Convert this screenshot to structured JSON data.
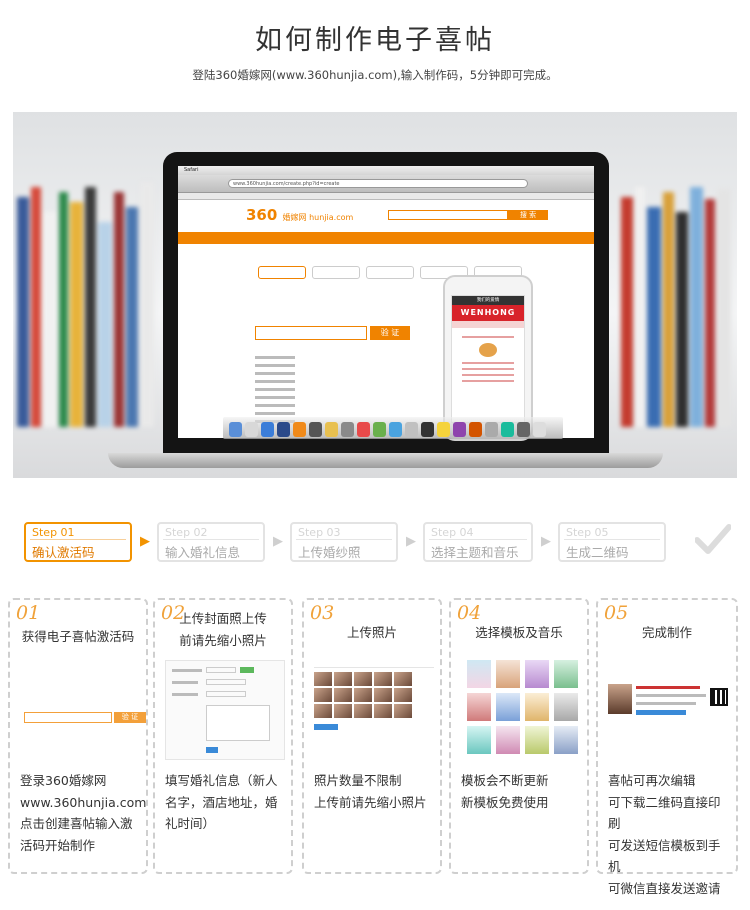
{
  "header": {
    "title": "如何制作电子喜帖",
    "subtitle": "登陆360婚嫁网(www.360hunjia.com),输入制作码，5分钟即可完成。"
  },
  "hero": {
    "browser_url": "www.360hunjia.com/create.php?id=create",
    "site_logo": "360",
    "site_logo_sub": "婚嫁网 hunjia.com",
    "site_search_btn": "搜 索",
    "screen_btn": "验 证",
    "phone_title": "我们的爱情",
    "phone_banner": "WENHONG",
    "menubar_app": "Safari"
  },
  "steps": [
    {
      "num": "Step 01",
      "label": "确认激活码",
      "active": true
    },
    {
      "num": "Step 02",
      "label": "输入婚礼信息",
      "active": false
    },
    {
      "num": "Step 03",
      "label": "上传婚纱照",
      "active": false
    },
    {
      "num": "Step 04",
      "label": "选择主题和音乐",
      "active": false
    },
    {
      "num": "Step 05",
      "label": "生成二维码",
      "active": false
    }
  ],
  "cards": [
    {
      "num": "01",
      "title": "获得电子喜帖激活码",
      "desc": "登录360婚嫁网\nwww.360hunjia.com\n点击创建喜帖输入激\n活码开始制作",
      "button": "验 证"
    },
    {
      "num": "02",
      "title": "上传封面照上传\n前请先缩小照片",
      "desc": "填写婚礼信息（新人\n名字，酒店地址，婚\n礼时间）"
    },
    {
      "num": "03",
      "title": "上传照片",
      "desc": "照片数量不限制\n上传前请先缩小照片"
    },
    {
      "num": "04",
      "title": "选择模板及音乐",
      "desc": "模板会不断更新\n新模板免费使用"
    },
    {
      "num": "05",
      "title": "完成制作",
      "desc": "喜帖可再次编辑\n可下载二维码直接印刷\n可发送短信模板到手机\n可微信直接发送邀请"
    }
  ],
  "colors": {
    "accent": "#f29300",
    "accent_dark": "#e07a00",
    "card_border": "#cfcfcf"
  },
  "icons": {
    "step_arrow": "chevron-right-icon",
    "finish": "check-icon"
  }
}
